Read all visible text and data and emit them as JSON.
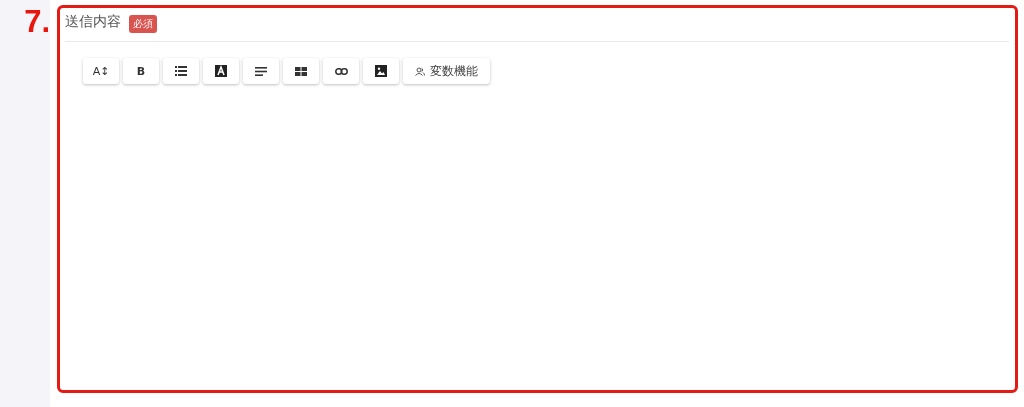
{
  "step_number": "7.",
  "field": {
    "label": "送信内容",
    "badge": "必須"
  },
  "toolbar": [
    {
      "kind": "text",
      "label": "A↕"
    },
    {
      "kind": "text",
      "label": "B"
    },
    {
      "kind": "icon"
    },
    {
      "kind": "icon"
    },
    {
      "kind": "icon"
    },
    {
      "kind": "icon"
    },
    {
      "kind": "icon"
    },
    {
      "kind": "icon"
    },
    {
      "kind": "icon-text",
      "label": "変数機能"
    }
  ]
}
